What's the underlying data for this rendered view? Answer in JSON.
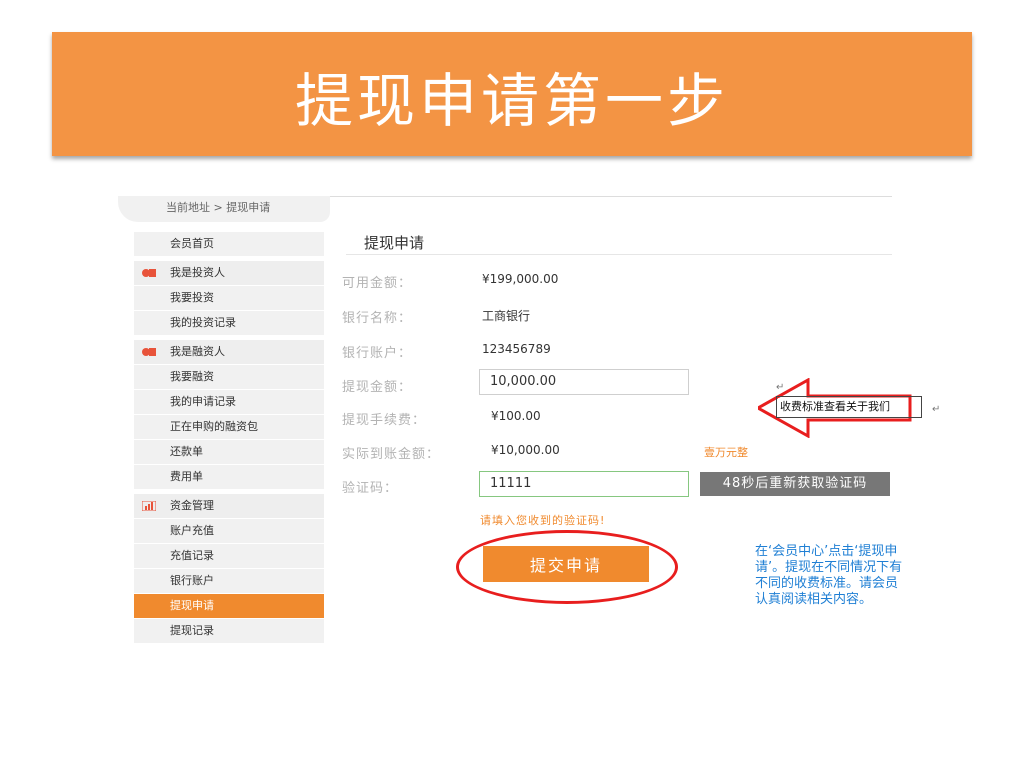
{
  "banner": {
    "title": "提现申请第一步"
  },
  "breadcrumb": {
    "text": "当前地址 > 提现申请"
  },
  "sidebar": {
    "items": [
      {
        "label": "会员首页"
      },
      {
        "label": "我是投资人"
      },
      {
        "label": "我要投资"
      },
      {
        "label": "我的投资记录"
      },
      {
        "label": "我是融资人"
      },
      {
        "label": "我要融资"
      },
      {
        "label": "我的申请记录"
      },
      {
        "label": "正在申购的融资包"
      },
      {
        "label": "还款单"
      },
      {
        "label": "费用单"
      },
      {
        "label": "资金管理"
      },
      {
        "label": "账户充值"
      },
      {
        "label": "充值记录"
      },
      {
        "label": "银行账户"
      },
      {
        "label": "提现申请"
      },
      {
        "label": "提现记录"
      }
    ]
  },
  "main": {
    "title": "提现申请",
    "available_label": "可用金额：",
    "available_value": "¥199,000.00",
    "bank_name_label": "银行名称：",
    "bank_name_value": "工商银行",
    "bank_account_label": "银行账户：",
    "bank_account_value": "123456789",
    "withdraw_amount_label": "提现金额：",
    "withdraw_amount_value": "10,000.00",
    "fee_label": "提现手续费：",
    "fee_value": "¥100.00",
    "actual_label": "实际到账金额：",
    "actual_value": "¥10,000.00",
    "actual_cn": "壹万元整",
    "code_label": "验证码：",
    "code_value": "11111",
    "resend_label": "48秒后重新获取验证码",
    "hint": "请填入您收到的验证码!",
    "submit_label": "提交申请"
  },
  "annotation": {
    "callout": "收费标准查看关于我们",
    "note": "在‘会员中心’点击‘提现申请’。提现在不同情况下有不同的收费标准。请会员认真阅读相关内容。",
    "para_mark_1": "↵",
    "para_mark_2": "↵"
  },
  "colors": {
    "accent": "#f08a2e",
    "banner": "#f39444",
    "annotation_red": "#e81e1e",
    "note_blue": "#1f7fd4"
  }
}
